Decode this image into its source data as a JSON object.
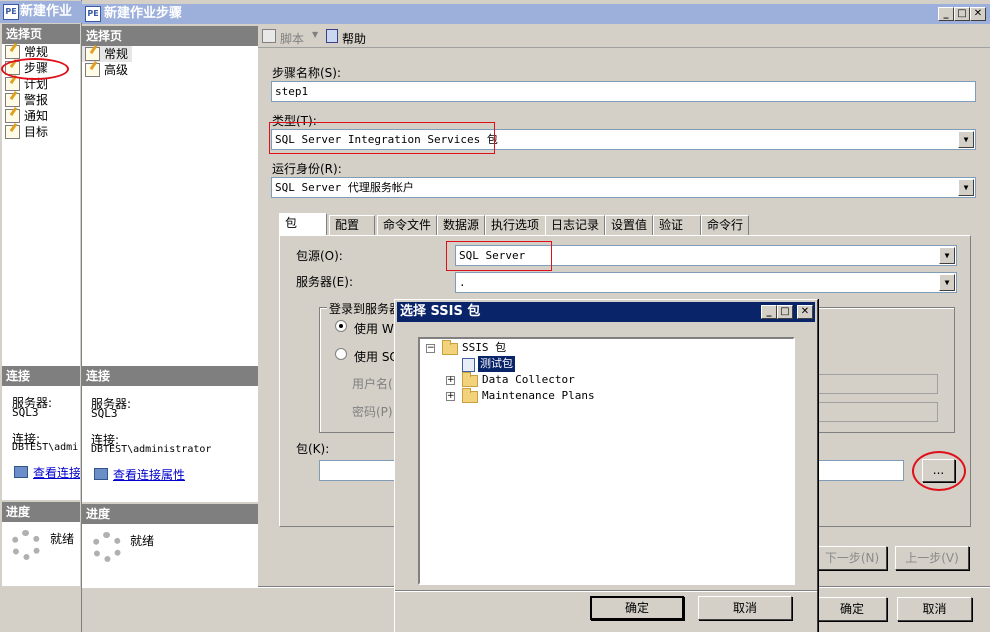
{
  "bg_window": {
    "title": "新建作业",
    "select_page_header": "选择页",
    "nav_items": [
      "常规",
      "步骤",
      "计划",
      "警报",
      "通知",
      "目标"
    ],
    "connection_header": "连接",
    "server_label": "服务器:",
    "server_value": "SQL3",
    "connection_label": "连接:",
    "connection_value": "DBTEST\\admi",
    "view_link": "查看连接",
    "progress_header": "进度",
    "progress_status": "就绪"
  },
  "step_window": {
    "title": "新建作业步骤",
    "select_page_header": "选择页",
    "nav_items": [
      "常规",
      "高级"
    ],
    "toolbar": {
      "script_label": "脚本",
      "help_label": "帮助"
    },
    "step_name_label": "步骤名称(S):",
    "step_name_value": "step1",
    "type_label": "类型(T):",
    "type_value": "SQL Server Integration Services 包",
    "run_as_label": "运行身份(R):",
    "run_as_value": "SQL Server 代理服务帐户",
    "tabs": [
      "包",
      "配置",
      "命令文件",
      "数据源",
      "执行选项",
      "日志记录",
      "设置值",
      "验证",
      "命令行"
    ],
    "package_source_label": "包源(O):",
    "package_source_value": "SQL Server",
    "server_label": "服务器(E):",
    "server_value": ".",
    "login_group_label": "登录到服务器",
    "use_windows_label": "使用 Wi",
    "use_sql_label": "使用 SQ",
    "username_label": "用户名(",
    "password_label": "密码(P)",
    "package_label": "包(K):",
    "package_value": "",
    "browse_label": "...",
    "connection_header": "连接",
    "conn_server_label": "服务器:",
    "conn_server_value": "SQL3",
    "conn_label": "连接:",
    "conn_value": "DBTEST\\administrator",
    "view_link": "查看连接属性",
    "progress_header": "进度",
    "progress_status": "就绪",
    "next_label": "下一步(N)",
    "prev_label": "上一步(V)",
    "ok_label": "确定",
    "cancel_label": "取消"
  },
  "ssis_dialog": {
    "title": "选择 SSIS 包",
    "tree": {
      "root": "SSIS 包",
      "items": [
        "测试包",
        "Data Collector",
        "Maintenance Plans"
      ]
    },
    "ok_label": "确定",
    "cancel_label": "取消"
  },
  "colors": {
    "title_active": "#0a246a",
    "highlight_red": "#e0101a",
    "face": "#d4d0c8"
  }
}
